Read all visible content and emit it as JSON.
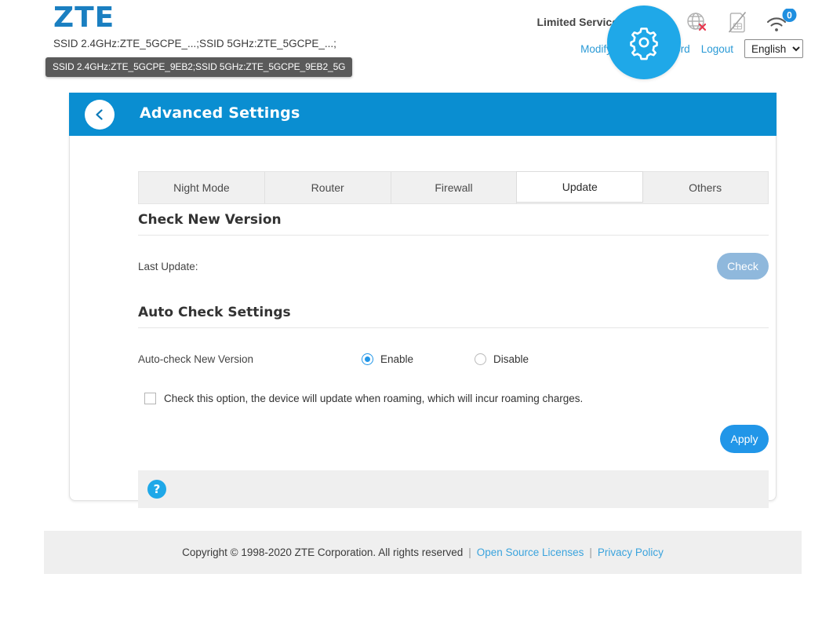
{
  "brand": {
    "logo_text": "ZTE"
  },
  "header": {
    "ssid_summary": "SSID 2.4GHz:ZTE_5GCPE_...;SSID 5GHz:ZTE_5GCPE_...;",
    "ssid_tooltip": "SSID 2.4GHz:ZTE_5GCPE_9EB2;SSID 5GHz:ZTE_5GCPE_9EB2_5G",
    "service_status": "Limited Service",
    "wifi_client_count": "0",
    "icons": {
      "signal": "signal-bars-error-icon",
      "network": "globe-error-icon",
      "sim": "sim-card-disabled-icon",
      "wifi": "wifi-icon"
    },
    "links": {
      "modify_password": "Modify Login Password",
      "logout": "Logout"
    },
    "language": {
      "selected": "English",
      "options": [
        "English"
      ]
    }
  },
  "card": {
    "title": "Advanced Settings",
    "back_icon": "chevron-left-icon",
    "gear_icon": "gear-icon"
  },
  "tabs": [
    {
      "label": "Night Mode",
      "active": false
    },
    {
      "label": "Router",
      "active": false
    },
    {
      "label": "Firewall",
      "active": false
    },
    {
      "label": "Update",
      "active": true
    },
    {
      "label": "Others",
      "active": false
    }
  ],
  "check_new_version": {
    "section_title": "Check New Version",
    "last_update_label": "Last Update:",
    "last_update_value": "",
    "check_button": "Check"
  },
  "auto_check_settings": {
    "section_title": "Auto Check Settings",
    "field_label": "Auto-check New Version",
    "options": [
      {
        "label": "Enable",
        "selected": true
      },
      {
        "label": "Disable",
        "selected": false
      }
    ],
    "roaming_checkbox": {
      "label": "Check this option, the device will update when roaming, which will incur roaming charges.",
      "checked": false
    },
    "apply_button": "Apply"
  },
  "help": {
    "icon": "question-mark-icon",
    "label": "?"
  },
  "footer": {
    "copyright": "Copyright © 1998-2020 ZTE Corporation. All rights reserved",
    "separator": "|",
    "open_source": "Open Source Licenses",
    "privacy": "Privacy Policy"
  },
  "colors": {
    "brand_blue": "#1a7fc1",
    "header_blue": "#0a8ed1",
    "accent_blue": "#2196e8",
    "gear_blue": "#1fa8e8",
    "disabled_blue": "#8fb8dc",
    "link_blue": "#2a9ad6",
    "panel_gray": "#efefef",
    "error_red": "#e8384f"
  }
}
